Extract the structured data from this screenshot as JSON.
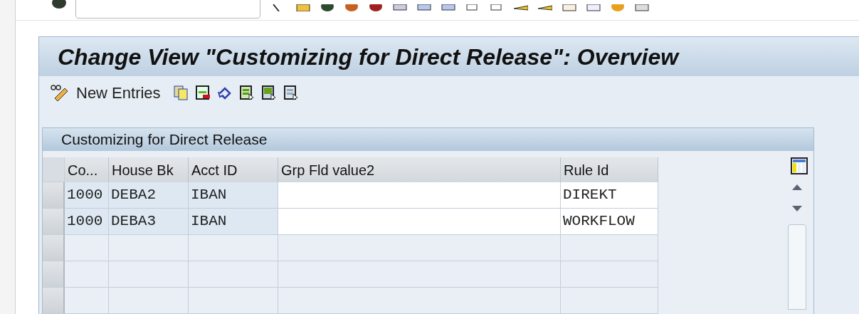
{
  "title": "Change View \"Customizing for Direct Release\": Overview",
  "app_toolbar": {
    "new_entries": "New Entries"
  },
  "table": {
    "title": "Customizing for Direct Release",
    "columns": [
      {
        "label": "Co...",
        "editable": false
      },
      {
        "label": "House Bk",
        "editable": false
      },
      {
        "label": "Acct ID",
        "editable": false
      },
      {
        "label": "Grp Fld value2",
        "editable": true
      },
      {
        "label": "Rule Id",
        "editable": true
      }
    ],
    "rows": [
      [
        "1000",
        "DEBA2",
        "IBAN",
        "",
        "DIREKT"
      ],
      [
        "1000",
        "DEBA3",
        "IBAN",
        "",
        "WORKFLOW"
      ]
    ]
  }
}
